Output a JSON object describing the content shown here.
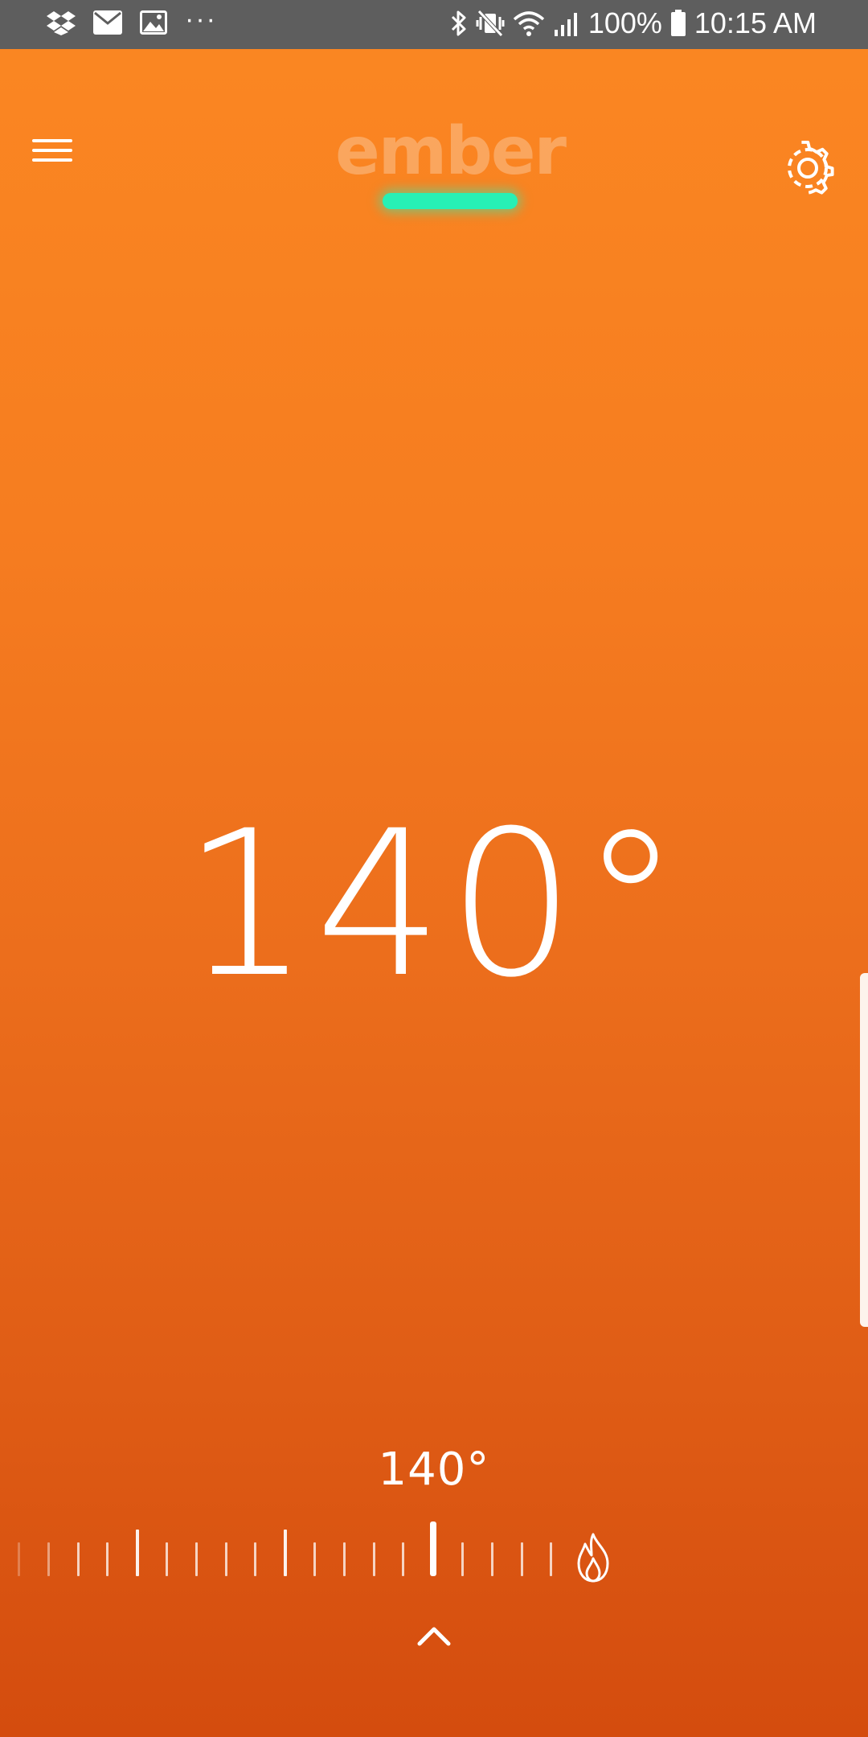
{
  "status_bar": {
    "battery_text": "100%",
    "time": "10:15 AM",
    "left_icons": [
      "dropbox-icon",
      "mail-icon",
      "image-icon",
      "more-icon"
    ],
    "right_icons": [
      "bluetooth-icon",
      "vibrate-mute-icon",
      "wifi-icon",
      "signal-icon",
      "battery-icon"
    ],
    "more_glyph": "···"
  },
  "header": {
    "brand": "ember",
    "menu_icon": "hamburger-menu-icon",
    "settings_icon": "gear-icon",
    "connection_indicator_color": "#27f0b5"
  },
  "main": {
    "current_temperature": "140°"
  },
  "controls": {
    "target_temperature": "140°",
    "heat_icon": "flame-icon",
    "expand_icon": "chevron-up-icon"
  },
  "colors": {
    "background_top": "#fb8722",
    "background_bottom": "#d44c0e",
    "status_bar": "#5e5e5e",
    "accent": "#27f0b5"
  }
}
